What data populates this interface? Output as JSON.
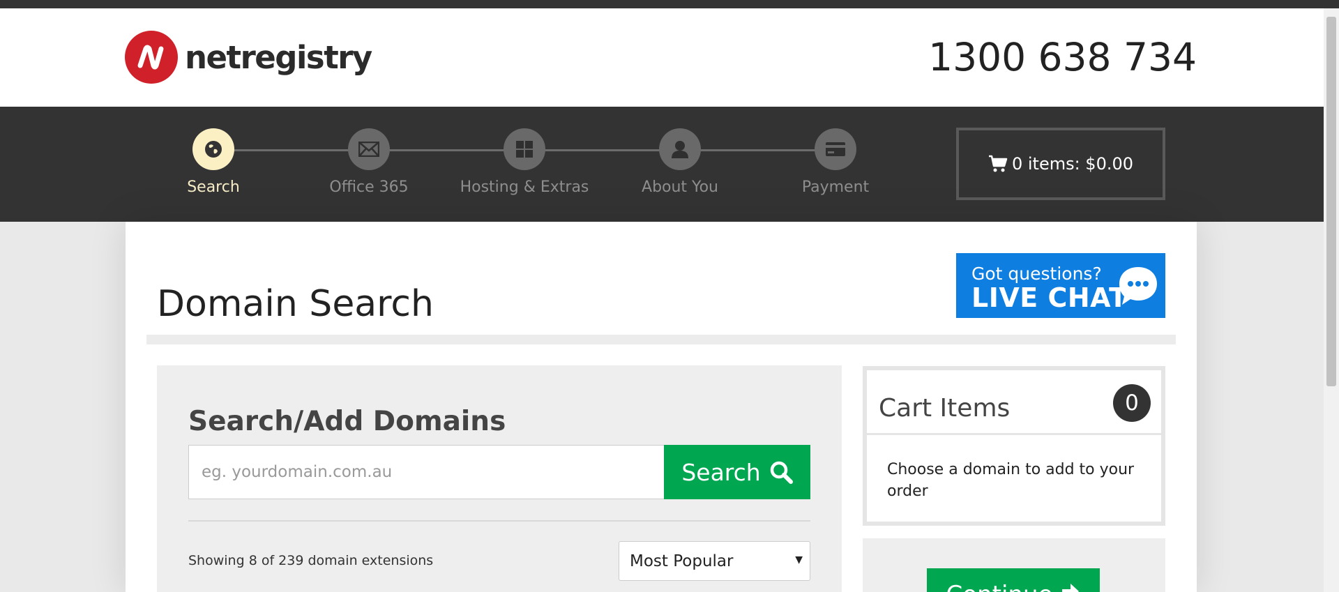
{
  "brand": {
    "name": "netregistry",
    "color": "#d0202a"
  },
  "phone": "1300 638 734",
  "steps": [
    {
      "label": "Search",
      "icon": "globe-icon",
      "active": true
    },
    {
      "label": "Office 365",
      "icon": "envelope-icon",
      "active": false
    },
    {
      "label": "Hosting & Extras",
      "icon": "grid-icon",
      "active": false
    },
    {
      "label": "About You",
      "icon": "user-icon",
      "active": false
    },
    {
      "label": "Payment",
      "icon": "credit-card-icon",
      "active": false
    }
  ],
  "cart_button": {
    "label": "0 items: $0.00",
    "icon": "cart-icon"
  },
  "page_title": "Domain Search",
  "live_chat": {
    "line1": "Got questions?",
    "line2": "LIVE CHAT",
    "icon": "chat-bubble-icon",
    "color": "#0e7fe1"
  },
  "search": {
    "title": "Search/Add Domains",
    "placeholder": "eg. yourdomain.com.au",
    "value": "",
    "button_label": "Search",
    "button_icon": "search-icon",
    "button_color": "#00a650",
    "showing_text": "Showing 8 of 239 domain extensions",
    "sort_selected": "Most Popular"
  },
  "cart_items": {
    "title": "Cart Items",
    "count": "0",
    "message": "Choose a domain to add to your order"
  },
  "continue": {
    "label": "Continue",
    "icon": "arrow-right-icon"
  }
}
